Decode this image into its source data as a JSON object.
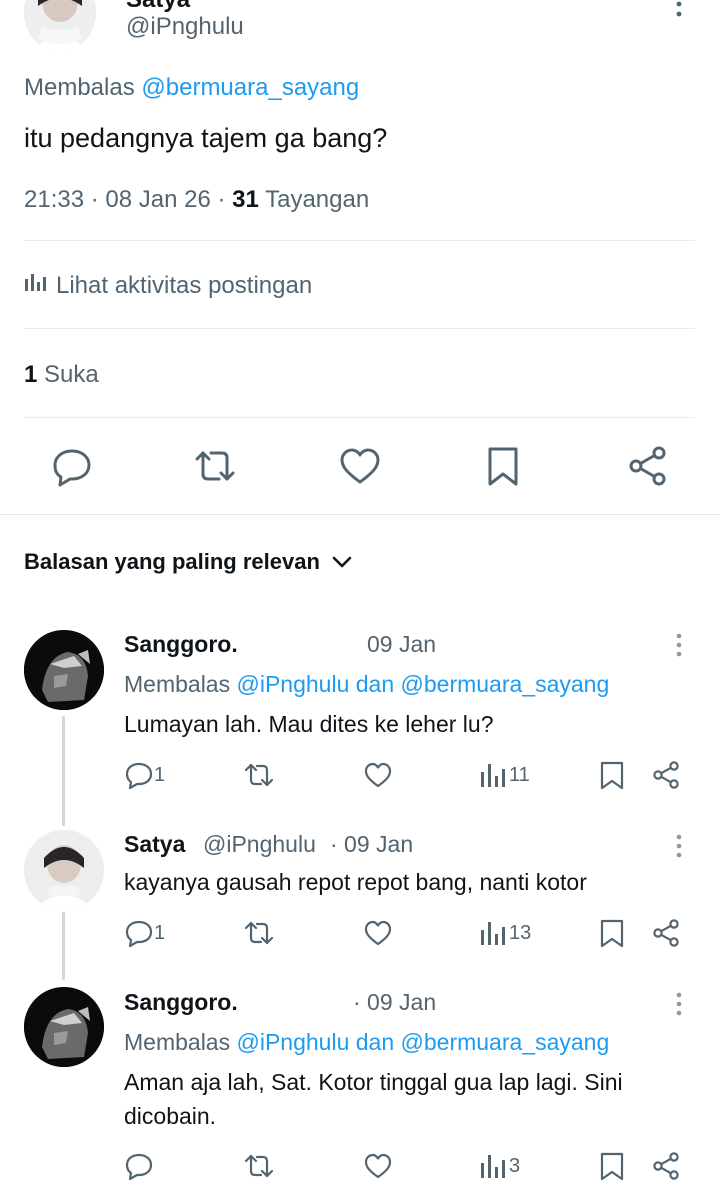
{
  "main_post": {
    "author_name": "Satya",
    "author_handle": "@iPnghulu",
    "replying_prefix": "Membalas",
    "replying_to": "@bermuara_sayang",
    "text": "itu pedangnya tajem ga bang?",
    "time": "21:33",
    "date": "08 Jan 26",
    "views_count": "31",
    "views_label": "Tayangan",
    "activity_label": "Lihat aktivitas postingan",
    "likes_count": "1",
    "likes_label": "Suka"
  },
  "sort_label": "Balasan yang paling relevan",
  "replies": [
    {
      "name": "Sanggoro.",
      "date": "09 Jan",
      "replying_prefix": "Membalas",
      "replying_to": "@iPnghulu dan @bermuara_sayang",
      "text_lines": [
        "Lumayan lah. Mau dites ke leher lu?"
      ],
      "reply_count": "1",
      "views_count": "11"
    },
    {
      "name": "Satya",
      "handle": "@iPnghulu",
      "date": "· 09 Jan",
      "text_lines": [
        "kayanya gausah repot repot bang, nanti kotor"
      ],
      "reply_count": "1",
      "views_count": "13"
    },
    {
      "name": "Sanggoro.",
      "date": "· 09 Jan",
      "replying_prefix": "Membalas",
      "replying_to": "@iPnghulu dan @bermuara_sayang",
      "text_lines": [
        "Aman aja lah, Sat. Kotor tinggal gua lap lagi. Sini",
        "dicobain."
      ],
      "reply_count": "",
      "views_count": "3"
    }
  ],
  "icons": {
    "reply": "reply-icon",
    "retweet": "retweet-icon",
    "like": "heart-icon",
    "bookmark": "bookmark-icon",
    "share": "share-icon",
    "views": "analytics-icon",
    "more": "more-icon"
  },
  "colors": {
    "link": "#1d9bf0",
    "secondary_text": "#536471",
    "primary_text": "#0f1419",
    "divider": "#e6ecf0"
  }
}
